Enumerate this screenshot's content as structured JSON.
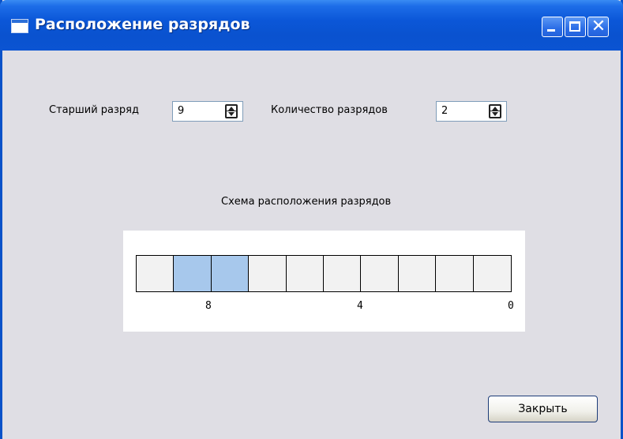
{
  "window": {
    "title": "Расположение разрядов",
    "controls": [
      "minimize-icon",
      "maximize-icon",
      "close-icon"
    ],
    "close_glyph": "✕"
  },
  "form": {
    "senior_bit_label": "Старший разряд",
    "senior_bit_value": "9",
    "count_label": "Количество разрядов",
    "count_value": "2"
  },
  "scheme": {
    "caption": "Схема расположения разрядов",
    "cells": [
      {
        "highlighted": false
      },
      {
        "highlighted": true
      },
      {
        "highlighted": true
      },
      {
        "highlighted": false
      },
      {
        "highlighted": false
      },
      {
        "highlighted": false
      },
      {
        "highlighted": false
      },
      {
        "highlighted": false
      },
      {
        "highlighted": false
      },
      {
        "highlighted": false
      }
    ],
    "ticks": [
      "8",
      "4",
      "0"
    ],
    "highlight_color": "#a7c8ec",
    "cell_color": "#f2f2f2"
  },
  "buttons": {
    "close_label": "Закрыть"
  },
  "colors": {
    "titlebar": "#0a52cf",
    "window_bg": "#dfdee4"
  }
}
